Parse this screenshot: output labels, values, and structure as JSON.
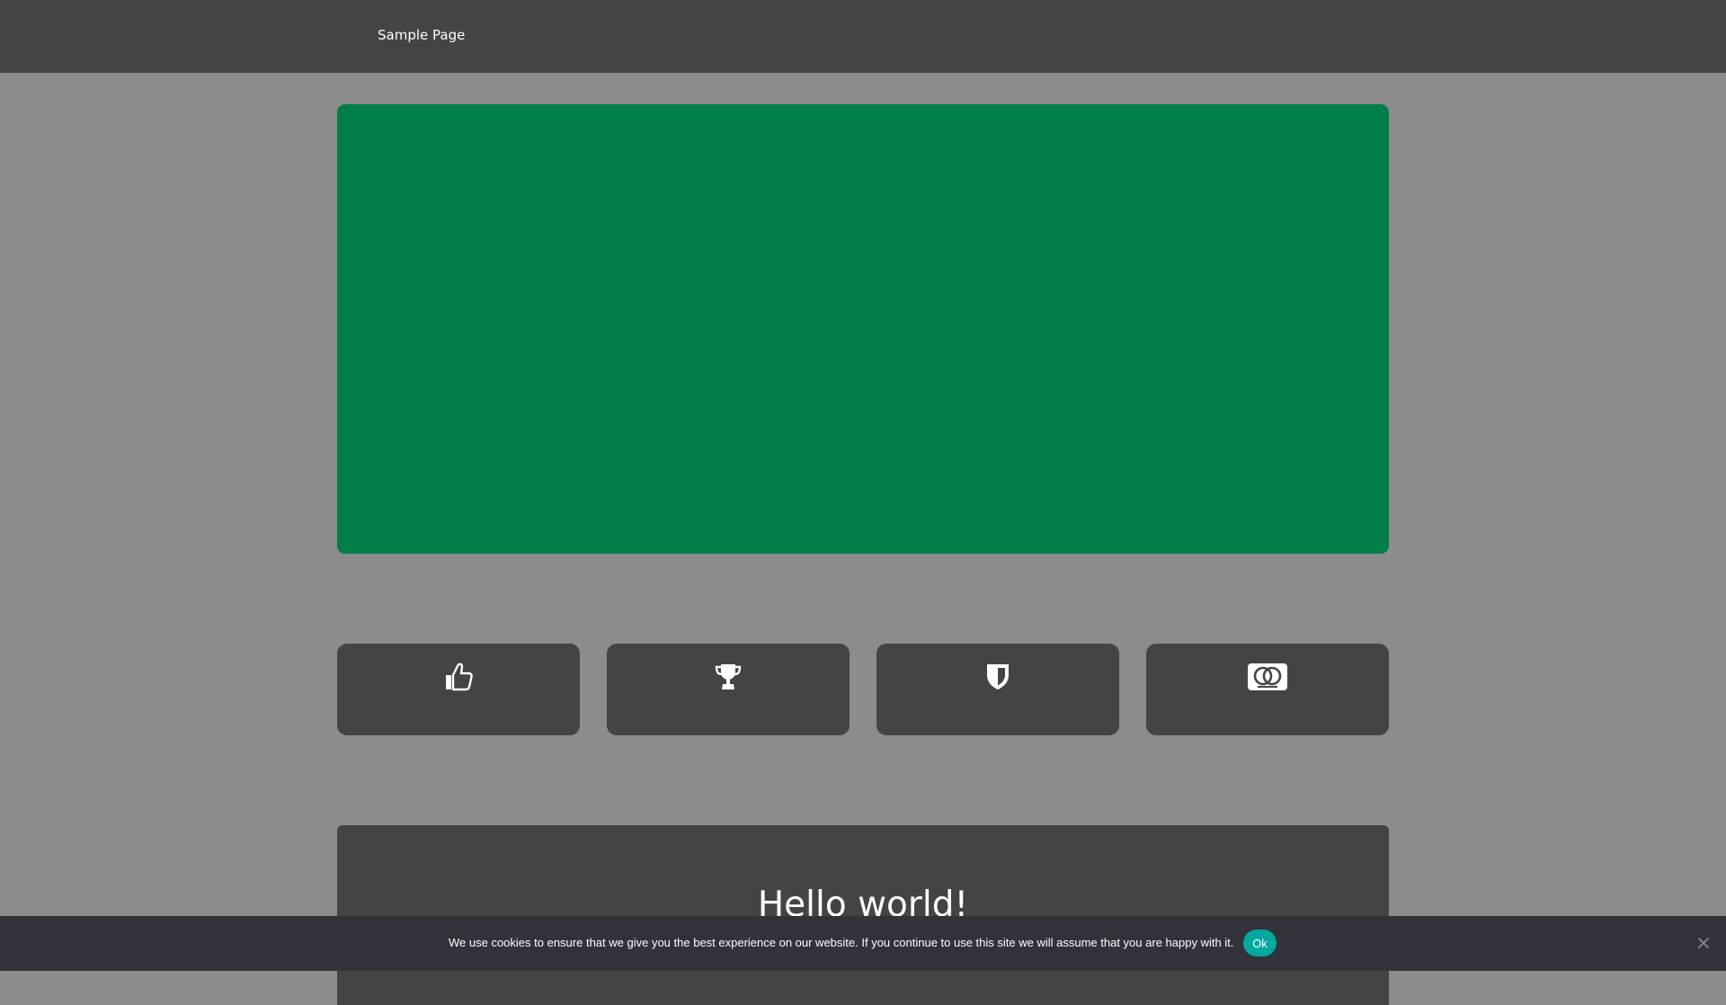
{
  "nav": {
    "items": [
      {
        "label": "Sample Page"
      }
    ]
  },
  "features": [
    {
      "icon": "thumbs-up-icon"
    },
    {
      "icon": "trophy-icon"
    },
    {
      "icon": "shield-icon"
    },
    {
      "icon": "mastercard-icon"
    }
  ],
  "post": {
    "title": "Hello world!"
  },
  "cookie_notice": {
    "text": "We use cookies to ensure that we give you the best experience on our website. If you continue to use this site we will assume that you are happy with it.",
    "ok_label": "Ok",
    "close_icon": "close-icon"
  },
  "colors": {
    "page_background": "#8c8c8c",
    "header_background": "#444444",
    "hero_background": "#007e47",
    "card_background": "#444444",
    "cookie_bar_background": "#32323a",
    "accent_button": "#00a99d"
  }
}
